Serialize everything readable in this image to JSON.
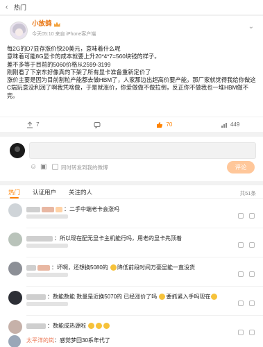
{
  "topbar": {
    "back_icon": "chevron-left-icon",
    "label": "热门"
  },
  "post": {
    "author_name": "小放鸽",
    "meta": "今天05:10 来自 iPhone客户端",
    "lines": [
      "每2G的D7显存涨价快20美元，意味着什么呢",
      "意味着可能8G显卡的成本就要上升20*4*7=560块钱的样子。",
      "差不多等于目前的5060价格从2599-3199",
      "刚刚看了下京东好像真的下架了所有显卡准备重新定价了",
      "涨价主要是因为目前割粒产能都去做HBM了，人家那边出超高价要产能，那厂家就觉得我给你做这C端玩意没利润了啊我凭啥做，于是就涨价，你爱做做不做拉倒，反正你不做我也一堆HBM做不完。"
    ],
    "reposts": "7",
    "comments": "",
    "likes": "70",
    "views": "449"
  },
  "composer": {
    "repost_label": "同时转发到我的微博",
    "submit_label": "评论"
  },
  "comments_section": {
    "tabs": [
      "热门",
      "认证用户",
      "关注的人"
    ],
    "total": "共51条",
    "items": [
      {
        "text": "：二手中端老卡会涨吗"
      },
      {
        "text": "：所以现在配无显卡主机能行吗，用老的显卡先顶着"
      },
      {
        "text": "：坏啊，还想换5080的",
        "tail": "降低前段时间万豪显能一直没货"
      },
      {
        "text": "：数能数能 数量是近换5070的 已经涨价了吗",
        "tail": "要抓紧入手吗现在"
      },
      {
        "text": "：数能成热源啦"
      },
      {
        "name": "太平洋的岚",
        "text": "：感觉梦回30系年代了"
      }
    ]
  }
}
